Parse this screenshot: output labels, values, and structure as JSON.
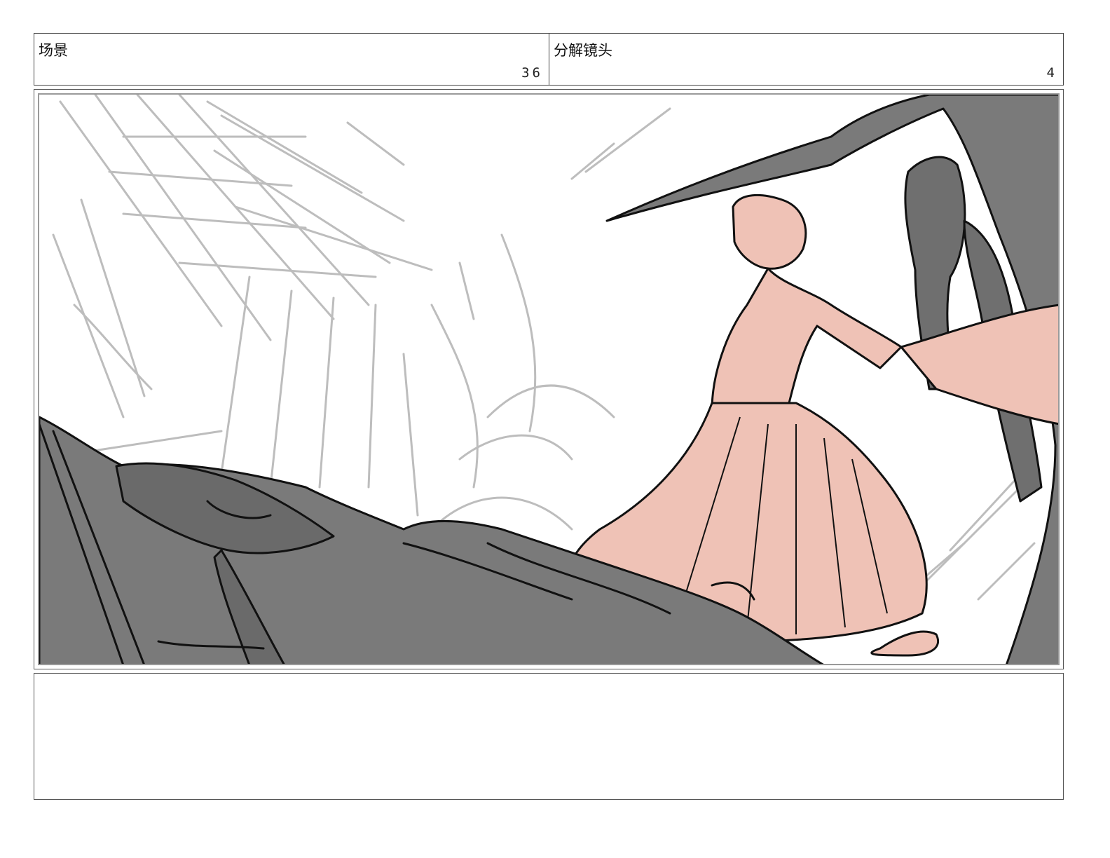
{
  "header": {
    "scene_label": "场景",
    "scene_number": "36",
    "shot_label": "分解镜头",
    "shot_number": "4"
  },
  "panel": {
    "style": "storyboard-sketch",
    "colors": {
      "sketch_gray": "#bdbdbd",
      "shadow_gray": "#7a7a7a",
      "skin_pink": "#efc2b6",
      "ink": "#111111"
    }
  },
  "notes": {
    "text": ""
  }
}
